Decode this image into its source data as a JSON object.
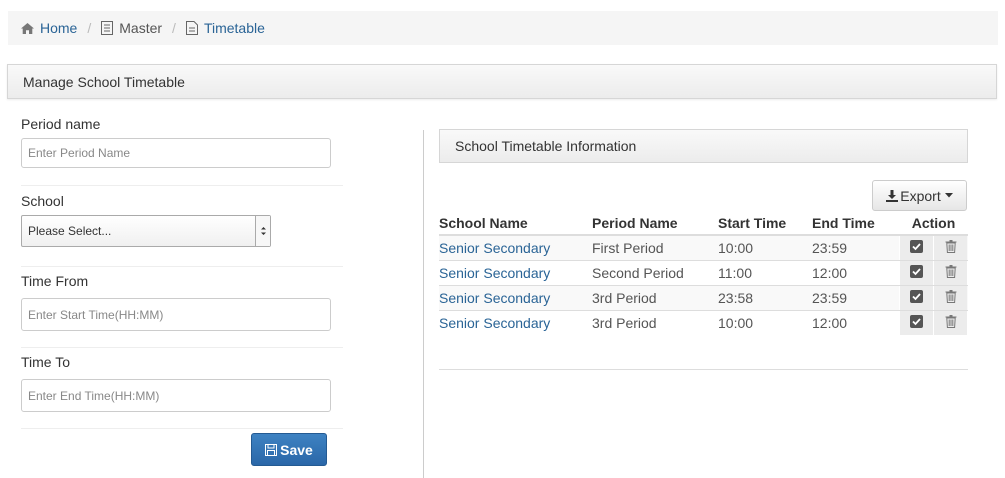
{
  "breadcrumb": {
    "home": "Home",
    "master": "Master",
    "current": "Timetable",
    "home_icon": "home-icon",
    "master_icon": "list-icon",
    "current_icon": "file-icon"
  },
  "panel": {
    "title": "Manage School Timetable"
  },
  "form": {
    "period_label": "Period name",
    "period_placeholder": "Enter Period Name",
    "school_label": "School",
    "school_value": "Please Select...",
    "from_label": "Time From",
    "from_placeholder": "Enter Start Time(HH:MM)",
    "to_label": "Time To",
    "to_placeholder": "Enter End Time(HH:MM)",
    "save_label": "Save"
  },
  "info": {
    "title": "School Timetable Information",
    "export_label": "Export",
    "columns": [
      "School Name",
      "Period Name",
      "Start Time",
      "End Time",
      "Action"
    ],
    "rows": [
      {
        "school": "Senior Secondary",
        "period": "First Period",
        "start": "10:00",
        "end": "23:59"
      },
      {
        "school": "Senior Secondary",
        "period": "Second Period",
        "start": "11:00",
        "end": "12:00"
      },
      {
        "school": "Senior Secondary",
        "period": "3rd Period",
        "start": "23:58",
        "end": "23:59"
      },
      {
        "school": "Senior Secondary",
        "period": "3rd Period",
        "start": "10:00",
        "end": "12:00"
      }
    ]
  },
  "colors": {
    "link": "#2a6496",
    "primary": "#2a67a8"
  }
}
